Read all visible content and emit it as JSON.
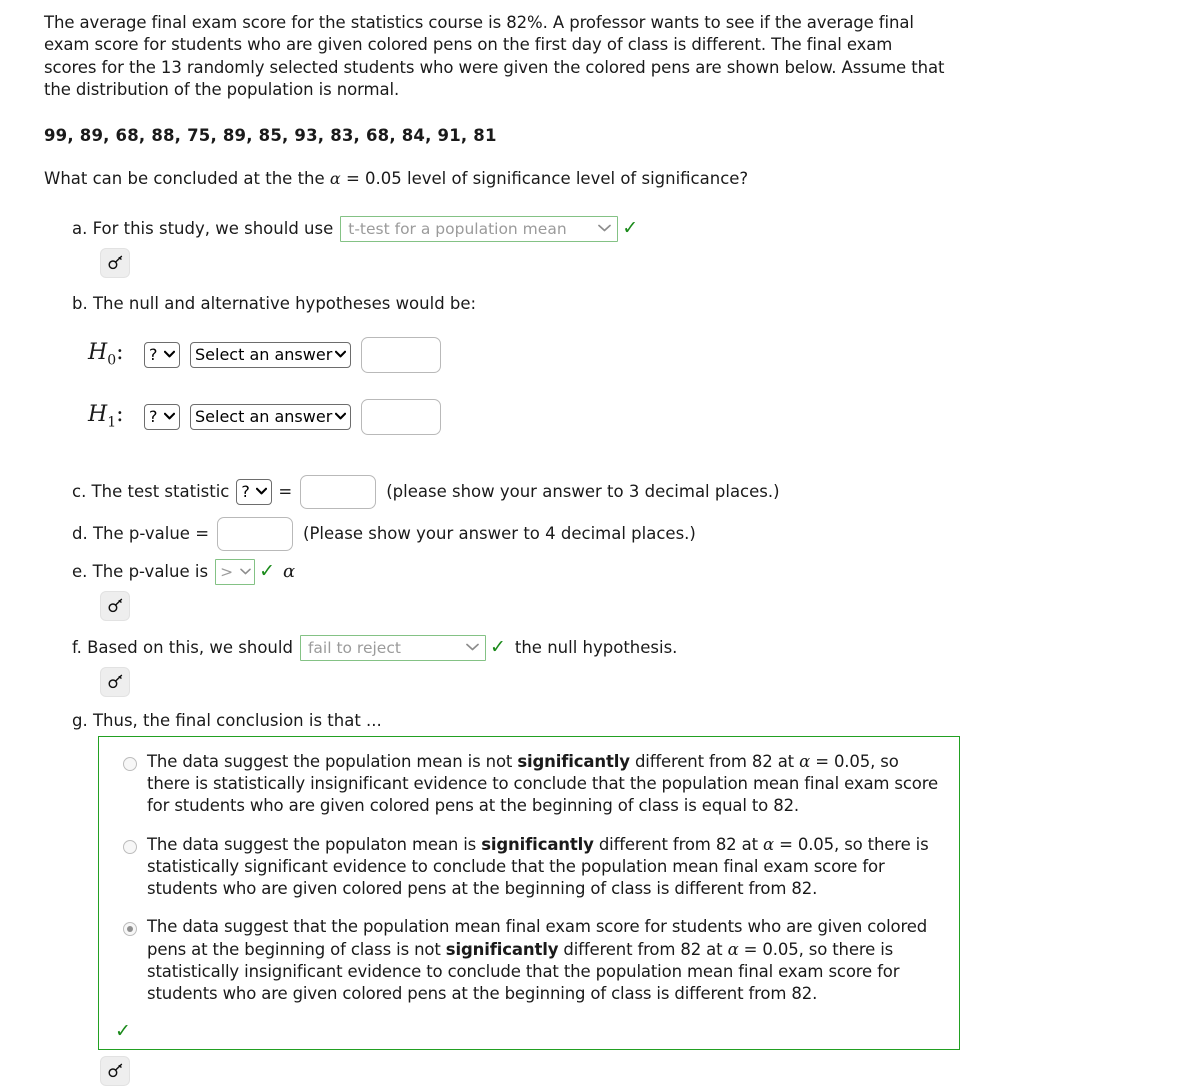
{
  "problem": {
    "intro": "The average final exam score for the statistics course is 82%. A professor wants to see if the average final exam score for students who are given colored pens on the first day of class is different. The final exam scores for the 13 randomly selected students who were given the colored pens are shown below. Assume that the distribution of the population is normal.",
    "data_values": "99, 89, 68, 88, 75, 89, 85, 93, 83, 68, 84, 91, 81",
    "question_prefix": "What can be concluded at the the ",
    "alpha_symbol": "α",
    "question_suffix": " = 0.05 level of significance level of significance?"
  },
  "parts": {
    "a": {
      "label": "a. For this study, we should use",
      "select_value": "t-test for a population mean",
      "chevron": "⌄",
      "check": "✓",
      "key_icon": "key-icon"
    },
    "b": {
      "label": "b. The null and alternative hypotheses would be:",
      "rows": [
        {
          "name": "H",
          "subscript": "0",
          "colon": ":",
          "param_select": "?",
          "answer_select": "Select an answer",
          "value": ""
        },
        {
          "name": "H",
          "subscript": "1",
          "colon": ":",
          "param_select": "?",
          "answer_select": "Select an answer",
          "value": ""
        }
      ],
      "chevron": "⌄",
      "bold_chevron": "❯"
    },
    "c": {
      "label_before": "c. The test statistic",
      "stat_select": "?",
      "equals": "=",
      "value": "",
      "note": "(please show your answer to 3 decimal places.)"
    },
    "d": {
      "label": "d. The p-value =",
      "value": "",
      "note": "(Please show your answer to 4 decimal places.)"
    },
    "e": {
      "label": "e. The p-value is",
      "comparison": ">",
      "check": "✓",
      "alpha": "α",
      "key_icon": "key-icon"
    },
    "f": {
      "label_before": "f. Based on this, we should",
      "decision": "fail to reject",
      "check": "✓",
      "label_after": "the null hypothesis.",
      "key_icon": "key-icon"
    },
    "g": {
      "label": "g. Thus, the final conclusion is that ...",
      "check": "✓",
      "key_icon": "key-icon",
      "options": [
        {
          "selected": false,
          "segments": [
            {
              "text": "The data suggest the population mean is not ",
              "bold": false
            },
            {
              "text": "significantly",
              "bold": true
            },
            {
              "text": " different from 82 at ",
              "bold": false
            },
            {
              "text": "α",
              "bold": false,
              "alpha": true
            },
            {
              "text": " = 0.05, so there is statistically insignificant evidence to conclude that the population mean final exam score for students who are given colored pens at the beginning of class is equal to 82.",
              "bold": false
            }
          ]
        },
        {
          "selected": false,
          "segments": [
            {
              "text": "The data suggest the populaton mean is ",
              "bold": false
            },
            {
              "text": "significantly",
              "bold": true
            },
            {
              "text": " different from 82 at ",
              "bold": false
            },
            {
              "text": "α",
              "bold": false,
              "alpha": true
            },
            {
              "text": " = 0.05, so there is statistically significant evidence to conclude that the population mean final exam score for students who are given colored pens at the beginning of class is different from 82.",
              "bold": false
            }
          ]
        },
        {
          "selected": true,
          "segments": [
            {
              "text": "The data suggest that the population mean final exam score for students who are given colored pens at the beginning of class is not ",
              "bold": false
            },
            {
              "text": "significantly",
              "bold": true
            },
            {
              "text": " different from 82 at ",
              "bold": false
            },
            {
              "text": "α",
              "bold": false,
              "alpha": true
            },
            {
              "text": " = 0.05, so there is statistically insignificant evidence to conclude that the population mean final exam score for students who are given colored pens at the beginning of class is different from 82.",
              "bold": false
            }
          ]
        }
      ]
    }
  },
  "colors": {
    "valid_green": "#22a022",
    "select_green": "#84c285",
    "placeholder_gray": "#9b9b9b"
  }
}
